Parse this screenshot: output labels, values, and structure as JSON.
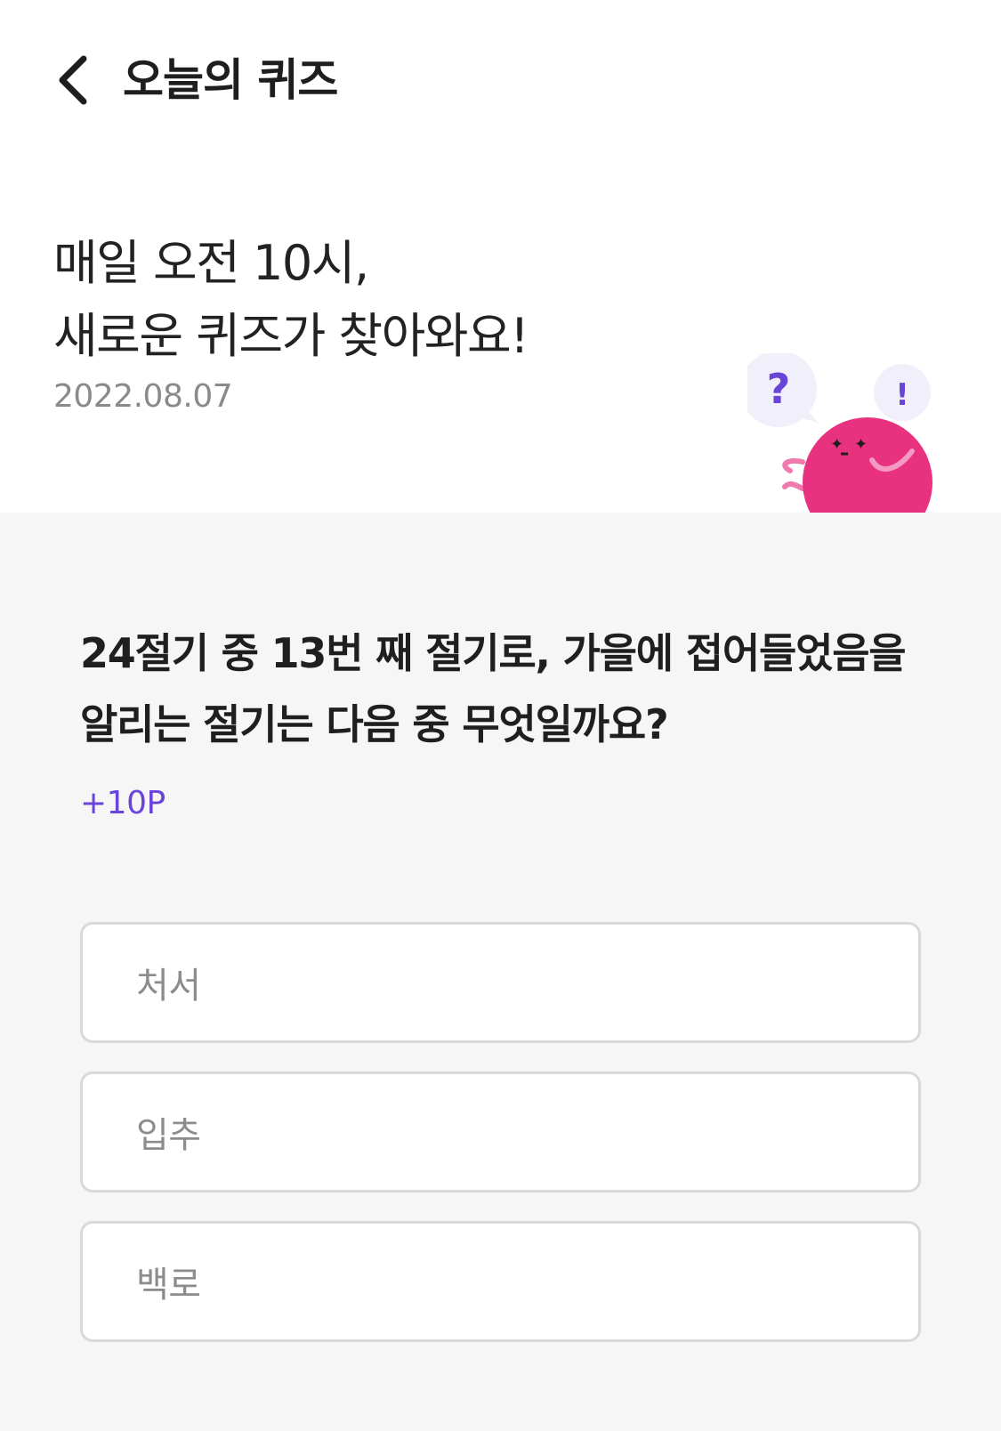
{
  "header": {
    "title": "오늘의 퀴즈"
  },
  "hero": {
    "line1": "매일 오전 10시,",
    "line2": "새로운 퀴즈가 찾아와요!",
    "date": "2022.08.07",
    "bubble_question": "?",
    "bubble_exclaim": "!"
  },
  "quiz": {
    "question": "24절기 중 13번 째 절기로, 가을에 접어들었음을 알리는 절기는 다음 중 무엇일까요?",
    "points": "+10P",
    "options": [
      "처서",
      "입추",
      "백로"
    ]
  },
  "colors": {
    "accent": "#6a44d6",
    "mascot": "#e8317f",
    "quiz_background": "#f6f6f6",
    "option_border": "#d9d9d9"
  },
  "icons": {
    "back": "chevron-left-icon",
    "mascot": "mascot-illustration"
  }
}
